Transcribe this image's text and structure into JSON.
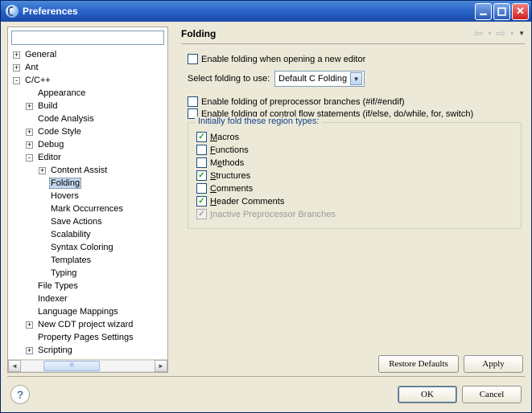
{
  "window": {
    "title": "Preferences"
  },
  "filter": {
    "value": ""
  },
  "tree": [
    {
      "depth": 0,
      "expander": "+",
      "label": "General"
    },
    {
      "depth": 0,
      "expander": "+",
      "label": "Ant"
    },
    {
      "depth": 0,
      "expander": "-",
      "label": "C/C++"
    },
    {
      "depth": 1,
      "expander": "",
      "label": "Appearance"
    },
    {
      "depth": 1,
      "expander": "+",
      "label": "Build"
    },
    {
      "depth": 1,
      "expander": "",
      "label": "Code Analysis"
    },
    {
      "depth": 1,
      "expander": "+",
      "label": "Code Style"
    },
    {
      "depth": 1,
      "expander": "+",
      "label": "Debug"
    },
    {
      "depth": 1,
      "expander": "-",
      "label": "Editor"
    },
    {
      "depth": 2,
      "expander": "+",
      "label": "Content Assist"
    },
    {
      "depth": 2,
      "expander": "",
      "label": "Folding",
      "selected": true
    },
    {
      "depth": 2,
      "expander": "",
      "label": "Hovers"
    },
    {
      "depth": 2,
      "expander": "",
      "label": "Mark Occurrences"
    },
    {
      "depth": 2,
      "expander": "",
      "label": "Save Actions"
    },
    {
      "depth": 2,
      "expander": "",
      "label": "Scalability"
    },
    {
      "depth": 2,
      "expander": "",
      "label": "Syntax Coloring"
    },
    {
      "depth": 2,
      "expander": "",
      "label": "Templates"
    },
    {
      "depth": 2,
      "expander": "",
      "label": "Typing"
    },
    {
      "depth": 1,
      "expander": "",
      "label": "File Types"
    },
    {
      "depth": 1,
      "expander": "",
      "label": "Indexer"
    },
    {
      "depth": 1,
      "expander": "",
      "label": "Language Mappings"
    },
    {
      "depth": 1,
      "expander": "+",
      "label": "New CDT project wizard"
    },
    {
      "depth": 1,
      "expander": "",
      "label": "Property Pages Settings"
    },
    {
      "depth": 1,
      "expander": "+",
      "label": "Scripting"
    }
  ],
  "page": {
    "title": "Folding",
    "enable_folding_label": "Enable folding when opening a new editor",
    "enable_folding_checked": false,
    "select_folding_label": "Select folding to use:",
    "select_folding_value": "Default C Folding",
    "enable_prep_label": "Enable folding of preprocessor branches (#if/#endif)",
    "enable_prep_checked": false,
    "enable_ctrl_label": "Enable folding of control flow statements (if/else, do/while, for, switch)",
    "enable_ctrl_checked": false,
    "group_title": "Initially fold these region types:",
    "regions": [
      {
        "key": "macros",
        "label_pre": "",
        "ul": "M",
        "label_post": "acros",
        "checked": true,
        "disabled": false
      },
      {
        "key": "functions",
        "label_pre": "",
        "ul": "F",
        "label_post": "unctions",
        "checked": false,
        "disabled": false
      },
      {
        "key": "methods",
        "label_pre": "M",
        "ul": "e",
        "label_post": "thods",
        "checked": false,
        "disabled": false
      },
      {
        "key": "structures",
        "label_pre": "",
        "ul": "S",
        "label_post": "tructures",
        "checked": true,
        "disabled": false
      },
      {
        "key": "comments",
        "label_pre": "",
        "ul": "C",
        "label_post": "omments",
        "checked": false,
        "disabled": false
      },
      {
        "key": "headercmt",
        "label_pre": "",
        "ul": "H",
        "label_post": "eader Comments",
        "checked": true,
        "disabled": false
      },
      {
        "key": "inactive",
        "label_pre": "",
        "ul": "I",
        "label_post": "nactive Preprocessor Branches",
        "checked": true,
        "disabled": true
      }
    ]
  },
  "buttons": {
    "restore_defaults": "Restore Defaults",
    "apply": "Apply",
    "ok": "OK",
    "cancel": "Cancel"
  }
}
